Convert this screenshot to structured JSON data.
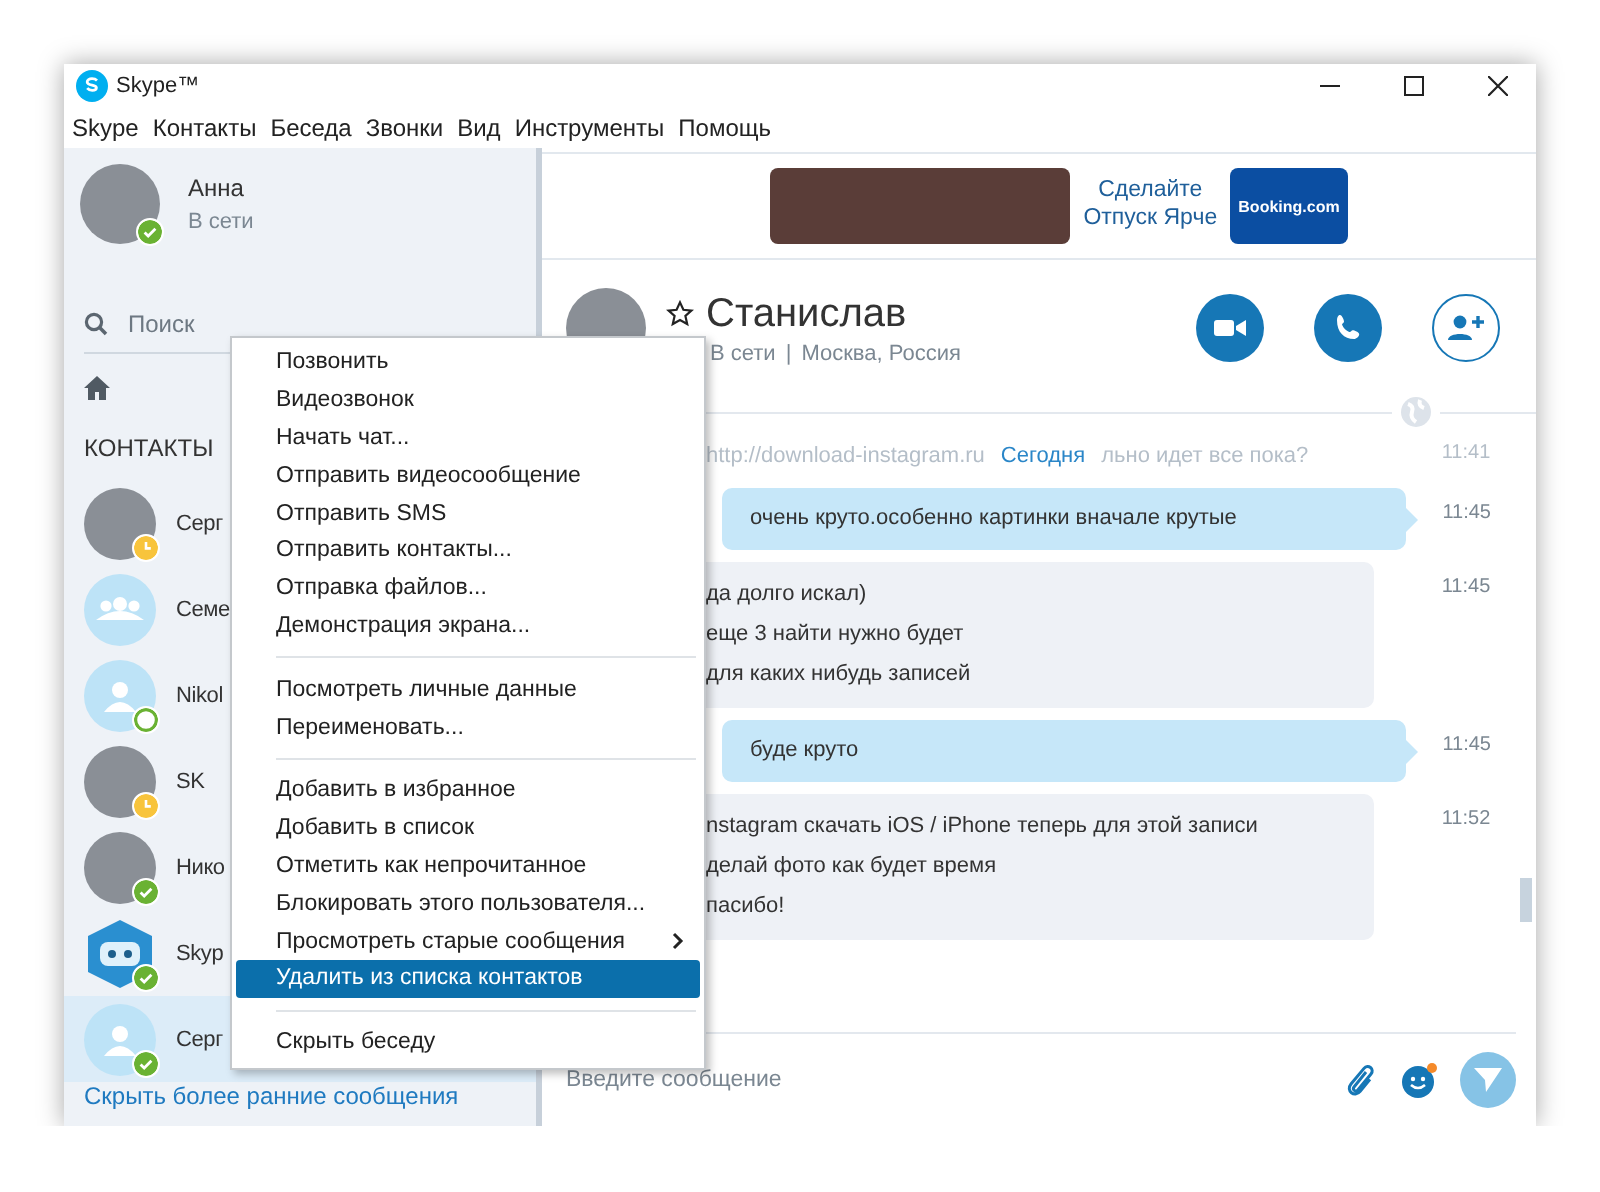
{
  "window": {
    "title": "Skype™"
  },
  "menu_bar": [
    "Skype",
    "Контакты",
    "Беседа",
    "Звонки",
    "Вид",
    "Инструменты",
    "Помощь"
  ],
  "profile": {
    "name": "Анна",
    "status_text": "В сети",
    "avatar": {
      "kind": "photo"
    },
    "badge": {
      "kind": "check",
      "color": "#6ab233"
    }
  },
  "search": {
    "placeholder": "Поиск"
  },
  "contacts_heading": "КОНТАКТЫ",
  "contacts": [
    {
      "name": "Серг",
      "avatar": {
        "kind": "photo"
      },
      "badge": {
        "kind": "clock",
        "color": "#f8c43c"
      },
      "selected": false
    },
    {
      "name": "Семе",
      "avatar": {
        "kind": "group"
      },
      "selected": false
    },
    {
      "name": "Nikol",
      "avatar": {
        "kind": "person"
      },
      "badge": {
        "kind": "ring",
        "color": "#6ab233"
      },
      "selected": false
    },
    {
      "name": "SK",
      "avatar": {
        "kind": "photo"
      },
      "badge": {
        "kind": "clock",
        "color": "#f8c43c"
      },
      "selected": false
    },
    {
      "name": "Нико",
      "avatar": {
        "kind": "photo"
      },
      "badge": {
        "kind": "check",
        "color": "#6ab233"
      },
      "selected": false
    },
    {
      "name": "Skyp",
      "avatar": {
        "kind": "bot"
      },
      "badge": {
        "kind": "check",
        "color": "#6ab233"
      },
      "selected": false
    },
    {
      "name": "Серг",
      "avatar": {
        "kind": "person"
      },
      "badge": {
        "kind": "check",
        "color": "#6ab233"
      },
      "selected": true
    }
  ],
  "hide_link": "Скрыть более ранние сообщения",
  "context_menu": {
    "groups": [
      [
        {
          "label": "Позвонить",
          "selected": false,
          "submenu": false
        },
        {
          "label": "Видеозвонок",
          "selected": false,
          "submenu": false
        },
        {
          "label": "Начать чат...",
          "selected": false,
          "submenu": false
        },
        {
          "label": "Отправить видеосообщение",
          "selected": false,
          "submenu": false
        },
        {
          "label": "Отправить SMS",
          "selected": false,
          "submenu": false
        },
        {
          "label": "Отправить контакты...",
          "selected": false,
          "submenu": false
        },
        {
          "label": "Отправка файлов...",
          "selected": false,
          "submenu": false
        },
        {
          "label": "Демонстрация экрана...",
          "selected": false,
          "submenu": false
        }
      ],
      [
        {
          "label": "Посмотреть личные данные",
          "selected": false,
          "submenu": false
        },
        {
          "label": "Переименовать...",
          "selected": false,
          "submenu": false
        }
      ],
      [
        {
          "label": "Добавить в избранное",
          "selected": false,
          "submenu": false
        },
        {
          "label": "Добавить в список",
          "selected": false,
          "submenu": false
        },
        {
          "label": "Отметить как непрочитанное",
          "selected": false,
          "submenu": false
        },
        {
          "label": "Блокировать этого пользователя...",
          "selected": false,
          "submenu": false
        },
        {
          "label": "Просмотреть старые сообщения",
          "selected": false,
          "submenu": true
        },
        {
          "label": "Удалить из списка контактов",
          "selected": true,
          "submenu": false
        }
      ],
      [
        {
          "label": "Скрыть беседу",
          "selected": false,
          "submenu": false
        }
      ]
    ]
  },
  "ad": {
    "text": "Сделайте Отпуск Ярче",
    "logo": "Booking.com"
  },
  "chat_header": {
    "name": "Станислав",
    "status_text": "В сети",
    "separator": "|",
    "location": "Москва, Россия",
    "avatar": {
      "kind": "photo"
    }
  },
  "date_divider": "Сегодня",
  "messages": [
    {
      "kind": "faded",
      "lines": [
        "http://download-instagram.ru",
        "льно идет все пока?"
      ],
      "time": "11:41"
    },
    {
      "kind": "out",
      "lines": [
        "очень круто.особенно картинки вначале крутые"
      ],
      "time": "11:45"
    },
    {
      "kind": "in",
      "lines": [
        "да долго искал)",
        "еще 3 найти нужно будет",
        "для каких нибудь записей"
      ],
      "time": "11:45"
    },
    {
      "kind": "out",
      "lines": [
        "буде круто"
      ],
      "time": "11:45"
    },
    {
      "kind": "in",
      "lines": [
        "nstagram скачать iOS / iPhone  теперь для этой записи",
        "делай фото как будет время",
        "пасибо!"
      ],
      "time": "11:52"
    }
  ],
  "composer": {
    "placeholder": "Введите сообщение"
  }
}
